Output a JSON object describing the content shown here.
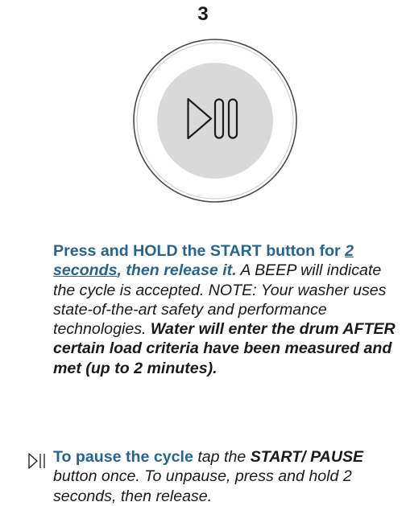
{
  "step": {
    "number": "3"
  },
  "start_button": {
    "icon": "play-pause-icon"
  },
  "instructions": {
    "part1": "Press and HOLD the START button for ",
    "part2": "2 seconds",
    "part3": ", then release it.",
    "part4": " A BEEP will indicate the cycle is accepted. NOTE: Your washer uses state-of-the-art safety and performance technologies. ",
    "part5": "Water will enter the drum AFTER certain load criteria have been measured and met (up to 2 minutes)."
  },
  "pause_note": {
    "icon": "play-pause-icon",
    "part1": "To pause the cycle",
    "part2": " tap the ",
    "part3": "START/ PAUSE",
    "part4": " button once. To unpause, press and hold 2 seconds, then release."
  },
  "colors": {
    "accent_blue": "#27648f",
    "text": "#1a1a1a",
    "button_gray": "#d9d9d9"
  }
}
